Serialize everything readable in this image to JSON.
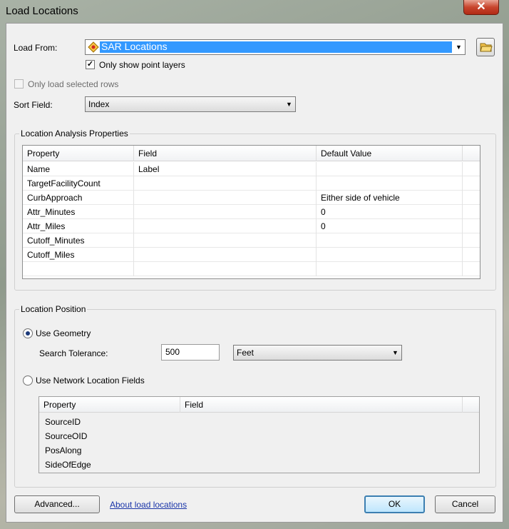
{
  "window": {
    "title": "Load Locations",
    "close_glyph": "✕"
  },
  "load_from": {
    "label": "Load From:",
    "value": "SAR Locations",
    "only_point_layers_label": "Only show point layers",
    "only_point_layers_checked": true
  },
  "only_selected_rows": {
    "label": "Only load selected rows",
    "checked": false,
    "enabled": false
  },
  "sort_field": {
    "label": "Sort Field:",
    "value": "Index"
  },
  "analysis_properties": {
    "title": "Location Analysis Properties",
    "columns": [
      "Property",
      "Field",
      "Default Value"
    ],
    "rows": [
      {
        "property": "Name",
        "field": "Label",
        "default": ""
      },
      {
        "property": "TargetFacilityCount",
        "field": "",
        "default": ""
      },
      {
        "property": "CurbApproach",
        "field": "",
        "default": "Either side of vehicle"
      },
      {
        "property": "Attr_Minutes",
        "field": "",
        "default": "0"
      },
      {
        "property": "Attr_Miles",
        "field": "",
        "default": "0"
      },
      {
        "property": "Cutoff_Minutes",
        "field": "",
        "default": ""
      },
      {
        "property": "Cutoff_Miles",
        "field": "",
        "default": ""
      },
      {
        "property": "",
        "field": "",
        "default": ""
      }
    ]
  },
  "location_position": {
    "title": "Location Position",
    "use_geometry_label": "Use Geometry",
    "use_geometry_selected": true,
    "search_tolerance_label": "Search Tolerance:",
    "search_tolerance_value": "500",
    "unit": "Feet",
    "use_network_label": "Use Network Location Fields",
    "use_network_selected": false,
    "network_columns": [
      "Property",
      "Field"
    ],
    "network_rows": [
      "SourceID",
      "SourceOID",
      "PosAlong",
      "SideOfEdge"
    ]
  },
  "footer": {
    "advanced_label": "Advanced...",
    "about_link": "About load locations",
    "ok_label": "OK",
    "cancel_label": "Cancel"
  },
  "colors": {
    "selection": "#3399ff",
    "default_button_border": "#3c7fb1",
    "link": "#1a35a8"
  }
}
